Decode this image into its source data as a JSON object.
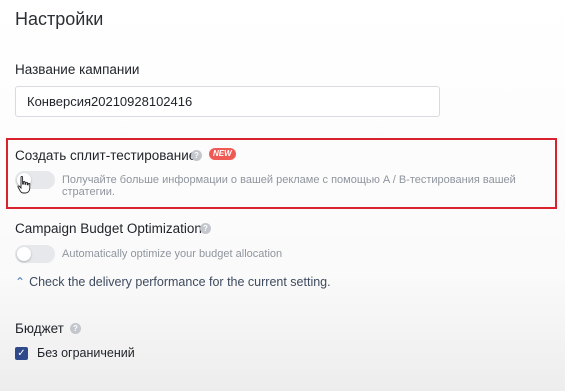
{
  "page": {
    "title": "Настройки"
  },
  "campaign_name": {
    "label": "Название кампании",
    "value": "Конверсия20210928102416"
  },
  "split_test": {
    "label": "Создать сплит-тестирование",
    "badge": "NEW",
    "toggle_on": false,
    "hint": "Получайте больше информации о вашей рекламе с помощью A / B-тестирования вашей стратегии."
  },
  "cbo": {
    "label": "Campaign Budget Optimization",
    "toggle_on": false,
    "hint": "Automatically optimize your budget allocation",
    "link_text": "Check the delivery performance for the current setting."
  },
  "budget": {
    "label": "Бюджет",
    "checkbox_label": "Без ограничений",
    "checked": true
  },
  "colors": {
    "highlight": "#d8232f",
    "badge": "#f05a54",
    "checkbox": "#2f4a8a"
  }
}
